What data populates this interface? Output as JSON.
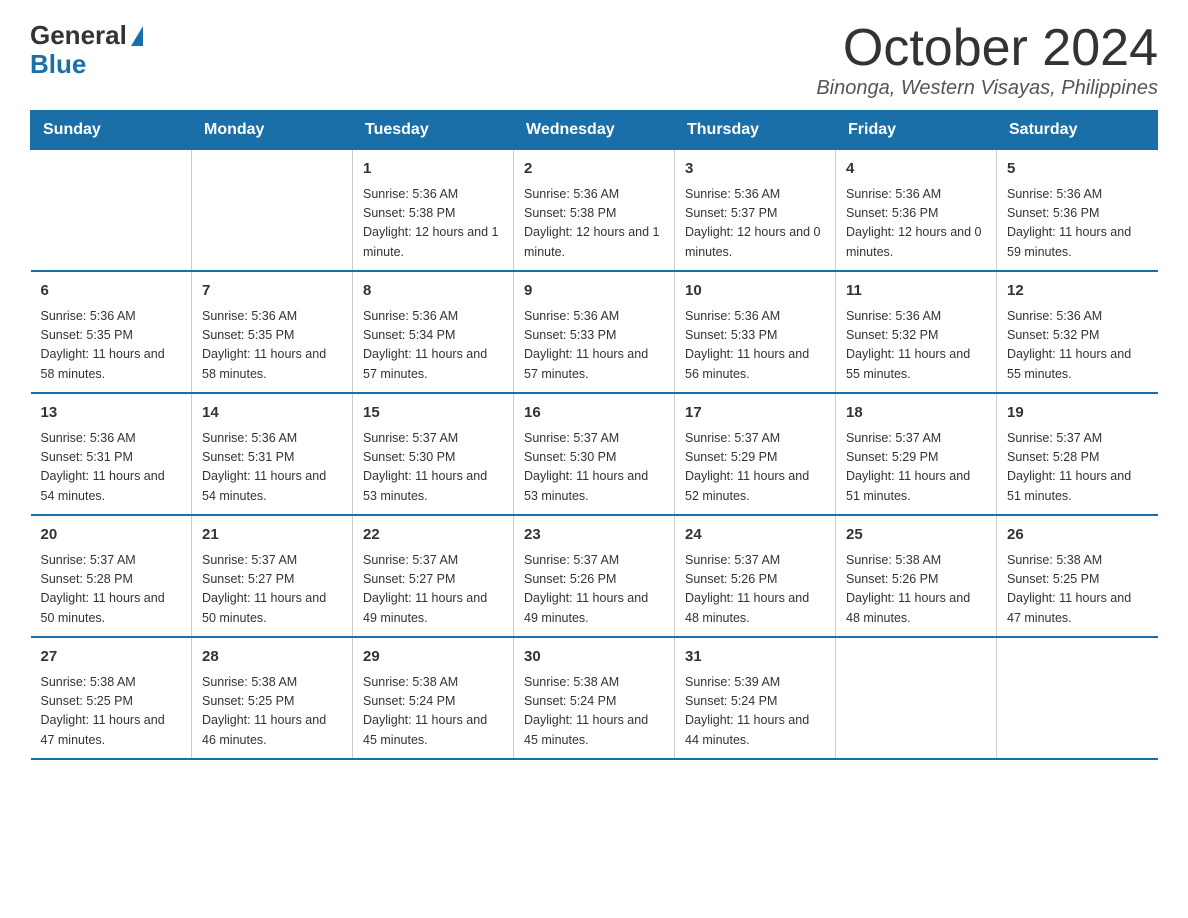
{
  "logo": {
    "general": "General",
    "blue": "Blue"
  },
  "title": {
    "month": "October 2024",
    "location": "Binonga, Western Visayas, Philippines"
  },
  "header": {
    "days": [
      "Sunday",
      "Monday",
      "Tuesday",
      "Wednesday",
      "Thursday",
      "Friday",
      "Saturday"
    ]
  },
  "weeks": [
    [
      {
        "day": "",
        "info": ""
      },
      {
        "day": "",
        "info": ""
      },
      {
        "day": "1",
        "info": "Sunrise: 5:36 AM\nSunset: 5:38 PM\nDaylight: 12 hours\nand 1 minute."
      },
      {
        "day": "2",
        "info": "Sunrise: 5:36 AM\nSunset: 5:38 PM\nDaylight: 12 hours\nand 1 minute."
      },
      {
        "day": "3",
        "info": "Sunrise: 5:36 AM\nSunset: 5:37 PM\nDaylight: 12 hours\nand 0 minutes."
      },
      {
        "day": "4",
        "info": "Sunrise: 5:36 AM\nSunset: 5:36 PM\nDaylight: 12 hours\nand 0 minutes."
      },
      {
        "day": "5",
        "info": "Sunrise: 5:36 AM\nSunset: 5:36 PM\nDaylight: 11 hours\nand 59 minutes."
      }
    ],
    [
      {
        "day": "6",
        "info": "Sunrise: 5:36 AM\nSunset: 5:35 PM\nDaylight: 11 hours\nand 58 minutes."
      },
      {
        "day": "7",
        "info": "Sunrise: 5:36 AM\nSunset: 5:35 PM\nDaylight: 11 hours\nand 58 minutes."
      },
      {
        "day": "8",
        "info": "Sunrise: 5:36 AM\nSunset: 5:34 PM\nDaylight: 11 hours\nand 57 minutes."
      },
      {
        "day": "9",
        "info": "Sunrise: 5:36 AM\nSunset: 5:33 PM\nDaylight: 11 hours\nand 57 minutes."
      },
      {
        "day": "10",
        "info": "Sunrise: 5:36 AM\nSunset: 5:33 PM\nDaylight: 11 hours\nand 56 minutes."
      },
      {
        "day": "11",
        "info": "Sunrise: 5:36 AM\nSunset: 5:32 PM\nDaylight: 11 hours\nand 55 minutes."
      },
      {
        "day": "12",
        "info": "Sunrise: 5:36 AM\nSunset: 5:32 PM\nDaylight: 11 hours\nand 55 minutes."
      }
    ],
    [
      {
        "day": "13",
        "info": "Sunrise: 5:36 AM\nSunset: 5:31 PM\nDaylight: 11 hours\nand 54 minutes."
      },
      {
        "day": "14",
        "info": "Sunrise: 5:36 AM\nSunset: 5:31 PM\nDaylight: 11 hours\nand 54 minutes."
      },
      {
        "day": "15",
        "info": "Sunrise: 5:37 AM\nSunset: 5:30 PM\nDaylight: 11 hours\nand 53 minutes."
      },
      {
        "day": "16",
        "info": "Sunrise: 5:37 AM\nSunset: 5:30 PM\nDaylight: 11 hours\nand 53 minutes."
      },
      {
        "day": "17",
        "info": "Sunrise: 5:37 AM\nSunset: 5:29 PM\nDaylight: 11 hours\nand 52 minutes."
      },
      {
        "day": "18",
        "info": "Sunrise: 5:37 AM\nSunset: 5:29 PM\nDaylight: 11 hours\nand 51 minutes."
      },
      {
        "day": "19",
        "info": "Sunrise: 5:37 AM\nSunset: 5:28 PM\nDaylight: 11 hours\nand 51 minutes."
      }
    ],
    [
      {
        "day": "20",
        "info": "Sunrise: 5:37 AM\nSunset: 5:28 PM\nDaylight: 11 hours\nand 50 minutes."
      },
      {
        "day": "21",
        "info": "Sunrise: 5:37 AM\nSunset: 5:27 PM\nDaylight: 11 hours\nand 50 minutes."
      },
      {
        "day": "22",
        "info": "Sunrise: 5:37 AM\nSunset: 5:27 PM\nDaylight: 11 hours\nand 49 minutes."
      },
      {
        "day": "23",
        "info": "Sunrise: 5:37 AM\nSunset: 5:26 PM\nDaylight: 11 hours\nand 49 minutes."
      },
      {
        "day": "24",
        "info": "Sunrise: 5:37 AM\nSunset: 5:26 PM\nDaylight: 11 hours\nand 48 minutes."
      },
      {
        "day": "25",
        "info": "Sunrise: 5:38 AM\nSunset: 5:26 PM\nDaylight: 11 hours\nand 48 minutes."
      },
      {
        "day": "26",
        "info": "Sunrise: 5:38 AM\nSunset: 5:25 PM\nDaylight: 11 hours\nand 47 minutes."
      }
    ],
    [
      {
        "day": "27",
        "info": "Sunrise: 5:38 AM\nSunset: 5:25 PM\nDaylight: 11 hours\nand 47 minutes."
      },
      {
        "day": "28",
        "info": "Sunrise: 5:38 AM\nSunset: 5:25 PM\nDaylight: 11 hours\nand 46 minutes."
      },
      {
        "day": "29",
        "info": "Sunrise: 5:38 AM\nSunset: 5:24 PM\nDaylight: 11 hours\nand 45 minutes."
      },
      {
        "day": "30",
        "info": "Sunrise: 5:38 AM\nSunset: 5:24 PM\nDaylight: 11 hours\nand 45 minutes."
      },
      {
        "day": "31",
        "info": "Sunrise: 5:39 AM\nSunset: 5:24 PM\nDaylight: 11 hours\nand 44 minutes."
      },
      {
        "day": "",
        "info": ""
      },
      {
        "day": "",
        "info": ""
      }
    ]
  ]
}
